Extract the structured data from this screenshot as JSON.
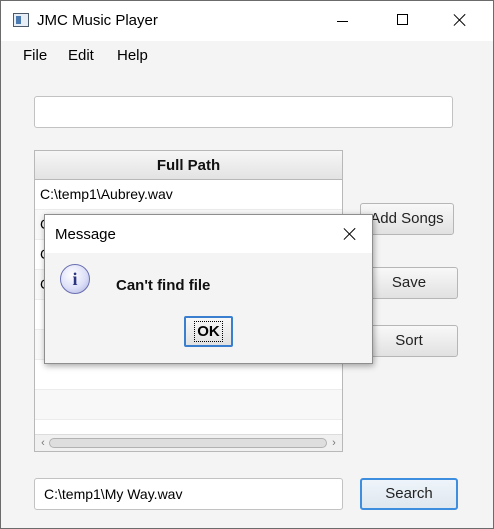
{
  "window": {
    "title": "JMC Music Player"
  },
  "menu": {
    "items": [
      "File",
      "Edit",
      "Help"
    ]
  },
  "path_input": {
    "value": ""
  },
  "table": {
    "header": "Full Path",
    "rows": [
      "C:\\temp1\\Aubrey.wav",
      "C",
      "C",
      "C",
      "",
      "",
      "",
      ""
    ]
  },
  "buttons": {
    "add_songs": "Add Songs",
    "save": "Save",
    "sort": "Sort",
    "search": "Search"
  },
  "search_input": {
    "value": "C:\\temp1\\My Way.wav"
  },
  "dialog": {
    "title": "Message",
    "icon": "info-icon",
    "icon_glyph": "i",
    "message": "Can't find file",
    "ok_label": "OK"
  },
  "icons": {
    "app": "app-icon",
    "minimize": "minimize-icon",
    "maximize": "maximize-icon",
    "close": "close-icon",
    "scroll_left": "chevron-left-icon",
    "scroll_right": "chevron-right-icon",
    "scroll_left_glyph": "‹",
    "scroll_right_glyph": "›"
  },
  "colors": {
    "focus_accent": "#3d8ede",
    "info_icon": "#6a6fb0"
  }
}
